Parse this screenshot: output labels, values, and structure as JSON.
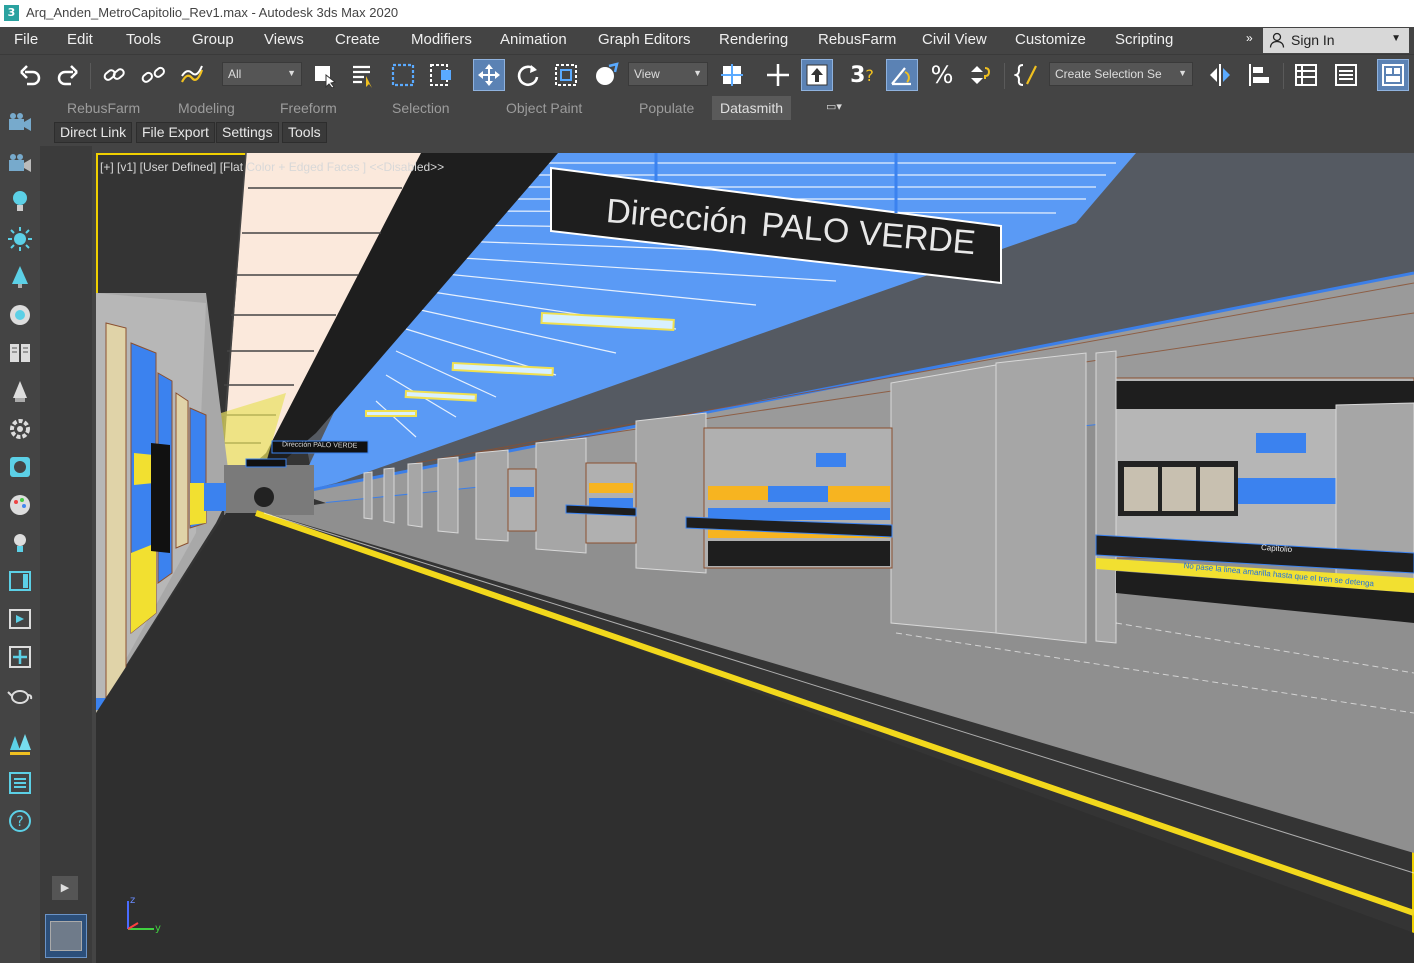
{
  "window": {
    "title": "Arq_Anden_MetroCapitolio_Rev1.max - Autodesk 3ds Max 2020",
    "app_icon_text": "3"
  },
  "menu": {
    "items": [
      "File",
      "Edit",
      "Tools",
      "Group",
      "Views",
      "Create",
      "Modifiers",
      "Animation",
      "Graph Editors",
      "Rendering",
      "RebusFarm",
      "Civil View",
      "Customize",
      "Scripting"
    ],
    "overflow": "»",
    "sign_in": "Sign In"
  },
  "toolbar": {
    "selection_filter": "All",
    "reference_coord": "View",
    "named_selection": "Create Selection Se",
    "snap_label": "3",
    "percent_snap": "%"
  },
  "ribbon": {
    "tabs": [
      "RebusFarm",
      "Modeling",
      "Freeform",
      "Selection",
      "Object Paint",
      "Populate",
      "Datasmith"
    ],
    "active_tab": "Datasmith",
    "sub_buttons": [
      "Direct Link",
      "File Export",
      "Settings",
      "Tools"
    ]
  },
  "viewport": {
    "label": "[+] [v1] [User Defined] [Flat Color + Edged Faces ]  <<Disabled>>",
    "sign_direction": "Dirección",
    "sign_destination": "PALO VERDE",
    "small_sign": "Dirección  PALO VERDE",
    "station_label": "Capitolio",
    "warning_text": "No pase la linea amarilla hasta que el tren se detenga",
    "gizmo_z": "z",
    "gizmo_y": "y"
  },
  "colors": {
    "ui_bg": "#444444",
    "active_blue": "#5b82b4",
    "viewport_border": "#f0d000",
    "wall_blue": "#3b82ef",
    "platform_line": "#f2d81c"
  },
  "icons": {
    "left_panel": [
      "camera-icon",
      "camera2-icon",
      "light-bulb-icon",
      "sun-icon",
      "tree-icon",
      "material-icon",
      "book-icon",
      "cone-icon",
      "gear-icon",
      "render-icon",
      "palette-icon",
      "bulb2-icon",
      "frame-icon",
      "frame2-icon",
      "move-icon",
      "teapot-icon",
      "forest-icon",
      "list-icon",
      "help-icon"
    ]
  }
}
